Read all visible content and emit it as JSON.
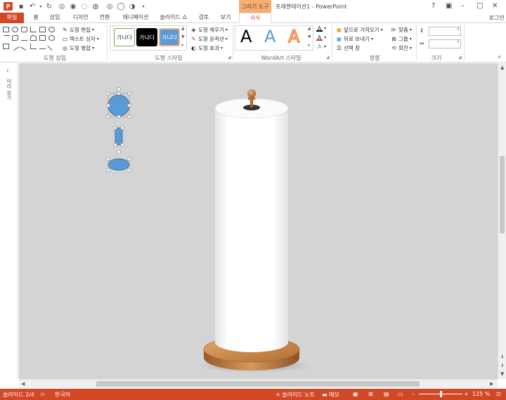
{
  "window": {
    "app_logo": "P",
    "context_tab_label": "그리기 도구",
    "title": "프레젠테이션1 - PowerPoint",
    "login": "로그인"
  },
  "tabs": [
    {
      "label": "파일"
    },
    {
      "label": "홈"
    },
    {
      "label": "삽입"
    },
    {
      "label": "디자인"
    },
    {
      "label": "전환"
    },
    {
      "label": "애니메이션"
    },
    {
      "label": "슬라이드 쇼"
    },
    {
      "label": "검토"
    },
    {
      "label": "보기"
    },
    {
      "label": "서식"
    }
  ],
  "ribbon": {
    "insert_shapes": {
      "label": "도형 삽입",
      "edit_shape": "도형 편집",
      "text_box": "텍스트 상자",
      "merge_shapes": "도형 병합"
    },
    "shape_styles": {
      "label": "도형 스타일",
      "samples": [
        "가나다",
        "가나다",
        "가나다"
      ],
      "fill": "도형 채우기",
      "outline": "도형 윤곽선",
      "effects": "도형 효과"
    },
    "wordart": {
      "label": "WordArt 스타일",
      "letters": [
        "A",
        "A",
        "A"
      ]
    },
    "arrange": {
      "label": "정렬",
      "bring_forward": "앞으로 가져오기",
      "send_backward": "뒤로 보내기",
      "selection_pane": "선택 창",
      "align": "맞춤",
      "group": "그룹",
      "rotate": "회전"
    },
    "size": {
      "label": "크기",
      "height": "",
      "width": ""
    }
  },
  "thumbnails": {
    "label": "미리 보기"
  },
  "statusbar": {
    "slide": "슬라이드 2/4",
    "language": "한국어",
    "notes": "슬라이드 노트",
    "comments": "메모",
    "zoom": "125 %"
  },
  "colors": {
    "accent": "#d24726",
    "context": "#f5ae73",
    "shape_blue": "#5b9bd5",
    "wood": "#c27a3f"
  }
}
